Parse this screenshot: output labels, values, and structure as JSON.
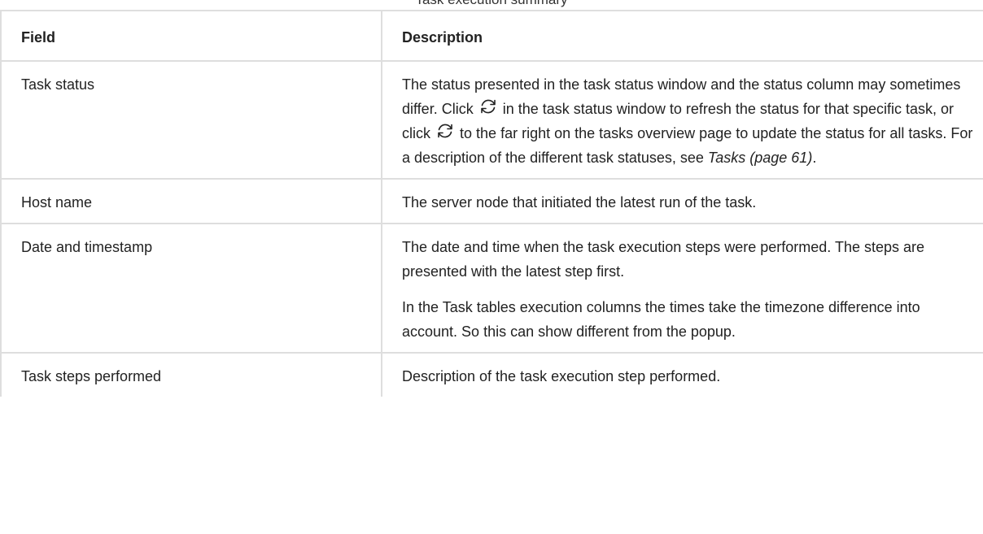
{
  "caption": "Task execution summary",
  "table": {
    "headers": {
      "field": "Field",
      "description": "Description"
    },
    "rows": [
      {
        "field": "Task status",
        "status_desc": {
          "t1": "The status presented in the task status window and the status column may sometimes differ. Click",
          "t2": "in the task status window to refresh the status for that specific task, or click",
          "t3": "to the far right on the tasks overview page to update the status for all tasks. For a description of the different task statuses, see",
          "link": "Tasks (page 61)",
          "t4": "."
        },
        "icon": "refresh-icon"
      },
      {
        "field": "Host name",
        "paragraphs": [
          "The server node that initiated the latest run of the task."
        ]
      },
      {
        "field": "Date and timestamp",
        "paragraphs": [
          "The date and time when the task execution steps were performed. The steps are presented with the latest step first.",
          "In the Task tables execution columns the times take the timezone difference into account. So this can show different from the popup."
        ]
      },
      {
        "field": "Task steps performed",
        "paragraphs": [
          "Description of the task execution step performed."
        ]
      }
    ]
  }
}
